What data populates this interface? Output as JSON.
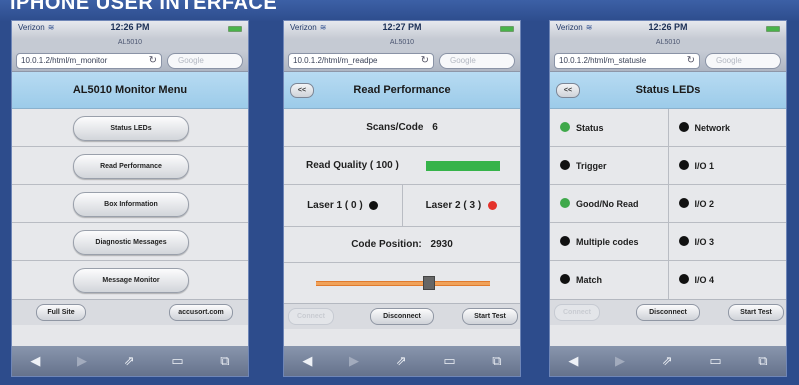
{
  "banner": {
    "title": "iPHONE USER INTERFACE"
  },
  "phones": [
    {
      "status": {
        "carrier": "Verizon",
        "time": "12:26 PM"
      },
      "page_title": "AL5010",
      "url": "10.0.1.2/html/m_monitor",
      "search_placeholder": "Google",
      "header": "AL5010 Monitor Menu",
      "menu": [
        "Status LEDs",
        "Read Performance",
        "Box Information",
        "Diagnostic Messages",
        "Message Monitor"
      ],
      "buttons": {
        "full_site": "Full Site",
        "accusort": "accusort.com"
      }
    },
    {
      "status": {
        "carrier": "Verizon",
        "time": "12:27 PM"
      },
      "page_title": "AL5010",
      "url": "10.0.1.2/html/m_readpe",
      "search_placeholder": "Google",
      "header": "Read Performance",
      "back": "<<",
      "scans_label": "Scans/Code",
      "scans_value": "6",
      "read_quality_label": "Read Quality ( 100 )",
      "read_quality_fraction": 1.0,
      "laser1_label": "Laser 1 ( 0 )",
      "laser2_label": "Laser 2 ( 3 )",
      "code_position_label": "Code Position:",
      "code_position_value": "2930",
      "slider_fraction": 0.66,
      "buttons": {
        "connect": "Connect",
        "disconnect": "Disconnect",
        "start_test": "Start Test"
      }
    },
    {
      "status": {
        "carrier": "Verizon",
        "time": "12:26 PM"
      },
      "page_title": "AL5010",
      "url": "10.0.1.2/html/m_statusle",
      "search_placeholder": "Google",
      "header": "Status LEDs",
      "back": "<<",
      "leds": [
        {
          "left": "Status",
          "left_color": "#3fa84a",
          "right": "Network",
          "right_color": "#111111"
        },
        {
          "left": "Trigger",
          "left_color": "#111111",
          "right": "I/O 1",
          "right_color": "#111111"
        },
        {
          "left": "Good/No Read",
          "left_color": "#3fa84a",
          "right": "I/O 2",
          "right_color": "#111111"
        },
        {
          "left": "Multiple codes",
          "left_color": "#111111",
          "right": "I/O 3",
          "right_color": "#111111"
        },
        {
          "left": "Match",
          "left_color": "#111111",
          "right": "I/O 4",
          "right_color": "#111111"
        }
      ],
      "buttons": {
        "connect": "Connect",
        "disconnect": "Disconnect",
        "start_test": "Start Test"
      }
    }
  ],
  "colors": {
    "header_blue": "#9ccbe9",
    "read_quality_bar": "#36b34a",
    "laser2_red": "#e4322b",
    "slider_track": "#f0a25a"
  },
  "icons": [
    "back-arrow-icon",
    "forward-arrow-icon",
    "share-icon",
    "bookmarks-icon",
    "tabs-icon",
    "reload-icon",
    "wifi-icon"
  ]
}
